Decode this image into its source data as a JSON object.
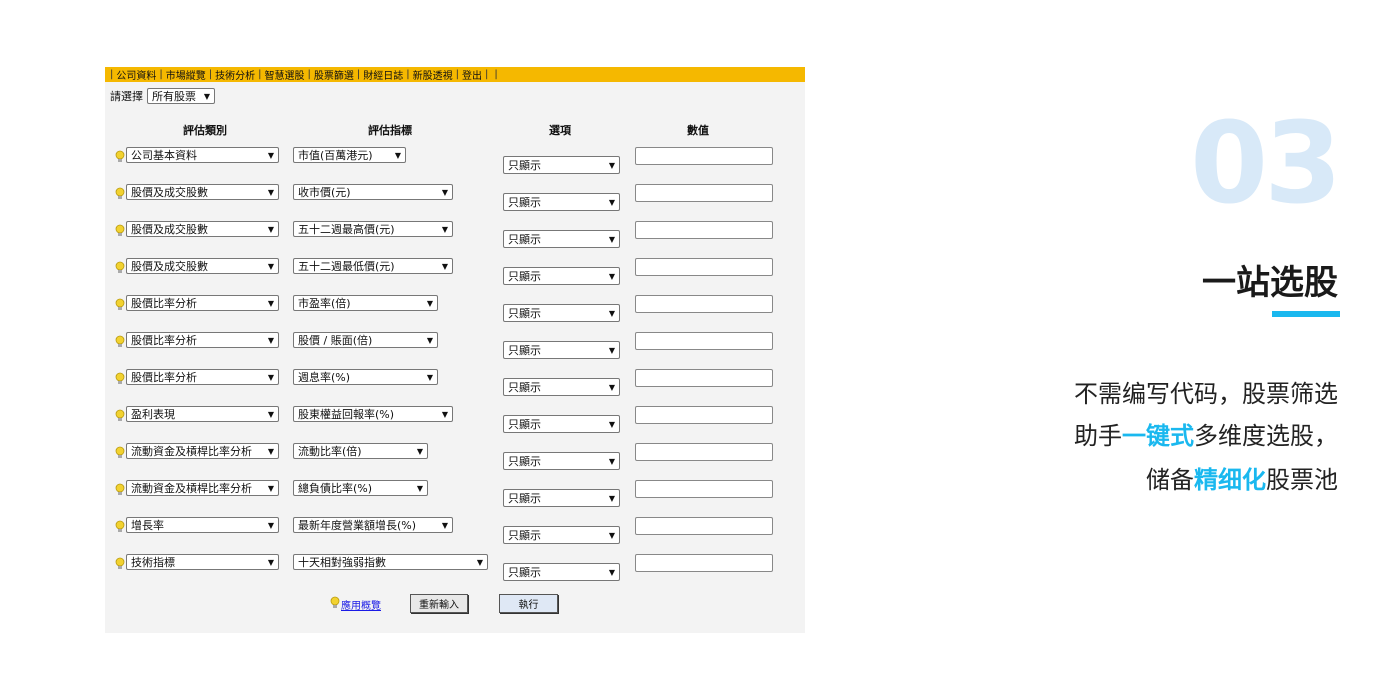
{
  "menu": [
    "公司資料",
    "市場縱覽",
    "技術分析",
    "智慧選股",
    "股票篩選",
    "財經日誌",
    "新股透視",
    "登出"
  ],
  "chooser": {
    "label": "請選擇",
    "value": "所有股票"
  },
  "columns": {
    "category": "評估類別",
    "indicator": "評估指標",
    "option": "選項",
    "value": "數值"
  },
  "rows": [
    {
      "category": "公司基本資料",
      "indicator": "市值(百萬港元)",
      "option": "只顯示",
      "value": ""
    },
    {
      "category": "股價及成交股數",
      "indicator": "收市價(元)",
      "option": "只顯示",
      "value": ""
    },
    {
      "category": "股價及成交股數",
      "indicator": "五十二週最高價(元)",
      "option": "只顯示",
      "value": ""
    },
    {
      "category": "股價及成交股數",
      "indicator": "五十二週最低價(元)",
      "option": "只顯示",
      "value": ""
    },
    {
      "category": "股價比率分析",
      "indicator": "市盈率(倍)",
      "option": "只顯示",
      "value": ""
    },
    {
      "category": "股價比率分析",
      "indicator": "股價 / 賬面(倍)",
      "option": "只顯示",
      "value": ""
    },
    {
      "category": "股價比率分析",
      "indicator": "週息率(%)",
      "option": "只顯示",
      "value": ""
    },
    {
      "category": "盈利表現",
      "indicator": "股東權益回報率(%)",
      "option": "只顯示",
      "value": ""
    },
    {
      "category": "流動資金及槓桿比率分析",
      "indicator": "流動比率(倍)",
      "option": "只顯示",
      "value": ""
    },
    {
      "category": "流動資金及槓桿比率分析",
      "indicator": "總負債比率(%)",
      "option": "只顯示",
      "value": ""
    },
    {
      "category": "增長率",
      "indicator": "最新年度營業額增長(%)",
      "option": "只顯示",
      "value": ""
    },
    {
      "category": "技術指標",
      "indicator": "十天相對強弱指數",
      "option": "只顯示",
      "value": ""
    }
  ],
  "footer": {
    "guide_link": "應用概覽",
    "reset_label": "重新輸入",
    "run_label": "執行"
  },
  "feature": {
    "number": "03",
    "title": "一站选股",
    "line1": "不需编写代码，股票筛选",
    "line2_pre": "助手",
    "line2_hl": "一键式",
    "line2_post": "多维度选股，",
    "line3_pre": "储备",
    "line3_hl": "精细化",
    "line3_post": "股票池"
  },
  "colors": {
    "menu_bg": "#f5b800",
    "accent": "#1ab8ef",
    "number": "#d8e9f8"
  }
}
